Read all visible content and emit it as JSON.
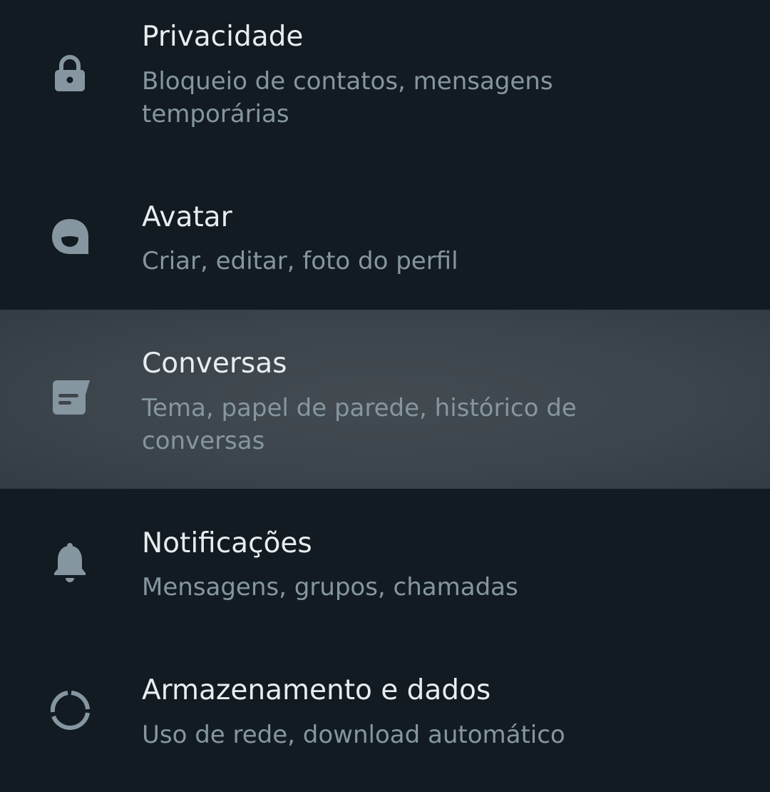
{
  "settings": {
    "items": [
      {
        "icon": "lock-icon",
        "title": "Privacidade",
        "subtitle": "Bloqueio de contatos, mensagens temporárias"
      },
      {
        "icon": "avatar-face-icon",
        "title": "Avatar",
        "subtitle": "Criar, editar, foto do perfil"
      },
      {
        "icon": "chat-message-icon",
        "title": "Conversas",
        "subtitle": "Tema, papel de parede, histórico de conversas"
      },
      {
        "icon": "bell-icon",
        "title": "Notificações",
        "subtitle": "Mensagens, grupos, chamadas"
      },
      {
        "icon": "data-usage-circle-icon",
        "title": "Armazenamento e dados",
        "subtitle": "Uso de rede, download automático"
      }
    ]
  },
  "colors": {
    "background": "#121b22",
    "highlight": "#3c454c",
    "title_text": "#e9edef",
    "subtitle_text": "#8696a0",
    "icon": "#8696a0"
  }
}
